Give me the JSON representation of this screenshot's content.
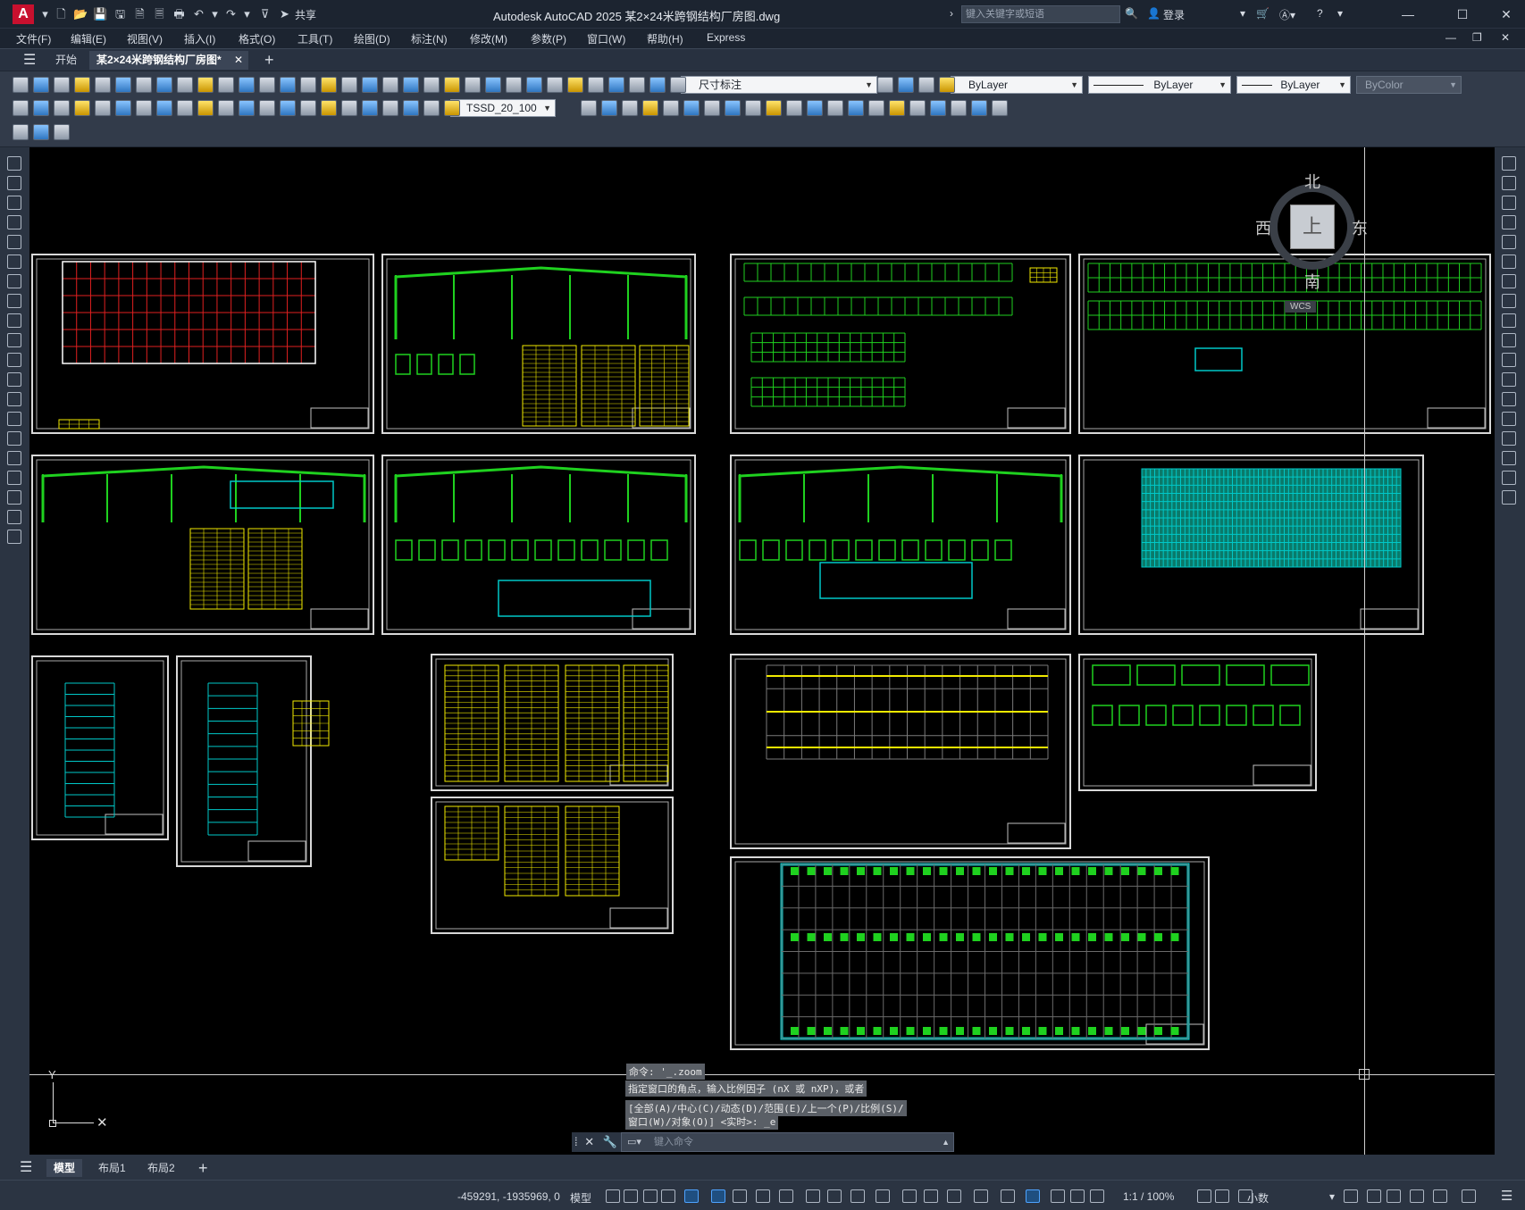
{
  "app": {
    "title": "Autodesk AutoCAD 2025    某2×24米跨钢结构厂房图.dwg",
    "logo_letter": "A",
    "share_label": "共享",
    "search_placeholder": "键入关键字或短语",
    "login_label": "登录",
    "help_label": "?"
  },
  "menu": {
    "items": [
      "文件(F)",
      "编辑(E)",
      "视图(V)",
      "插入(I)",
      "格式(O)",
      "工具(T)",
      "绘图(D)",
      "标注(N)",
      "修改(M)",
      "参数(P)",
      "窗口(W)",
      "帮助(H)",
      "Express"
    ]
  },
  "tabs": {
    "start": "开始",
    "doc": "某2×24米跨钢结构厂房图*",
    "add": "+"
  },
  "toolbar": {
    "dim_style": "尺寸标注",
    "layer_color": "ByLayer",
    "linetype": "ByLayer",
    "lineweight": "ByLayer",
    "plot_style": "ByColor",
    "text_style": "TSSD_20_100"
  },
  "viewcube": {
    "north": "北",
    "south": "南",
    "east": "东",
    "west": "西",
    "face": "上",
    "wcs": "WCS"
  },
  "command": {
    "history": [
      "命令: '_.zoom",
      "指定窗口的角点，输入比例因子 (nX 或 nXP)，或者",
      "[全部(A)/中心(C)/动态(D)/范围(E)/上一个(P)/比例(S)/",
      "窗口(W)/对象(O)] <实时>: _e"
    ],
    "placeholder": "键入命令"
  },
  "layouts": {
    "model": "模型",
    "layout1": "布局1",
    "layout2": "布局2",
    "add": "+"
  },
  "status": {
    "coords": "-459291, -1935969, 0",
    "mode": "模型",
    "scale": "1:1 / 100%",
    "units": "小数"
  },
  "colors": {
    "canvas": "#000000",
    "accent": "#c8102e",
    "drawing_green": "#1fd11f",
    "drawing_yellow": "#f2ea00",
    "drawing_cyan": "#00c8c8",
    "drawing_red": "#e02020"
  }
}
